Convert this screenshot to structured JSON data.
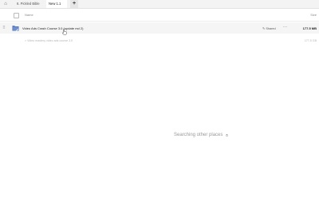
{
  "tabs": [
    {
      "label": "6. Pickled Bible"
    },
    {
      "label": "New 1.1"
    }
  ],
  "tab_add_label": "+",
  "header": {
    "name_label": "Name",
    "size_label": "Size"
  },
  "file": {
    "name": "Video Ads Crash Course 3.0 (update md 2)",
    "shared_label": "Shared",
    "more_label": "···",
    "size": "177.5 MB"
  },
  "sub_entry": {
    "path": "> Video mastery video ads course 3.0",
    "size": "177.5 GB"
  },
  "status": {
    "searching_text": "Searching other places"
  },
  "colors": {
    "folder_accent": "#4a6fb5"
  }
}
